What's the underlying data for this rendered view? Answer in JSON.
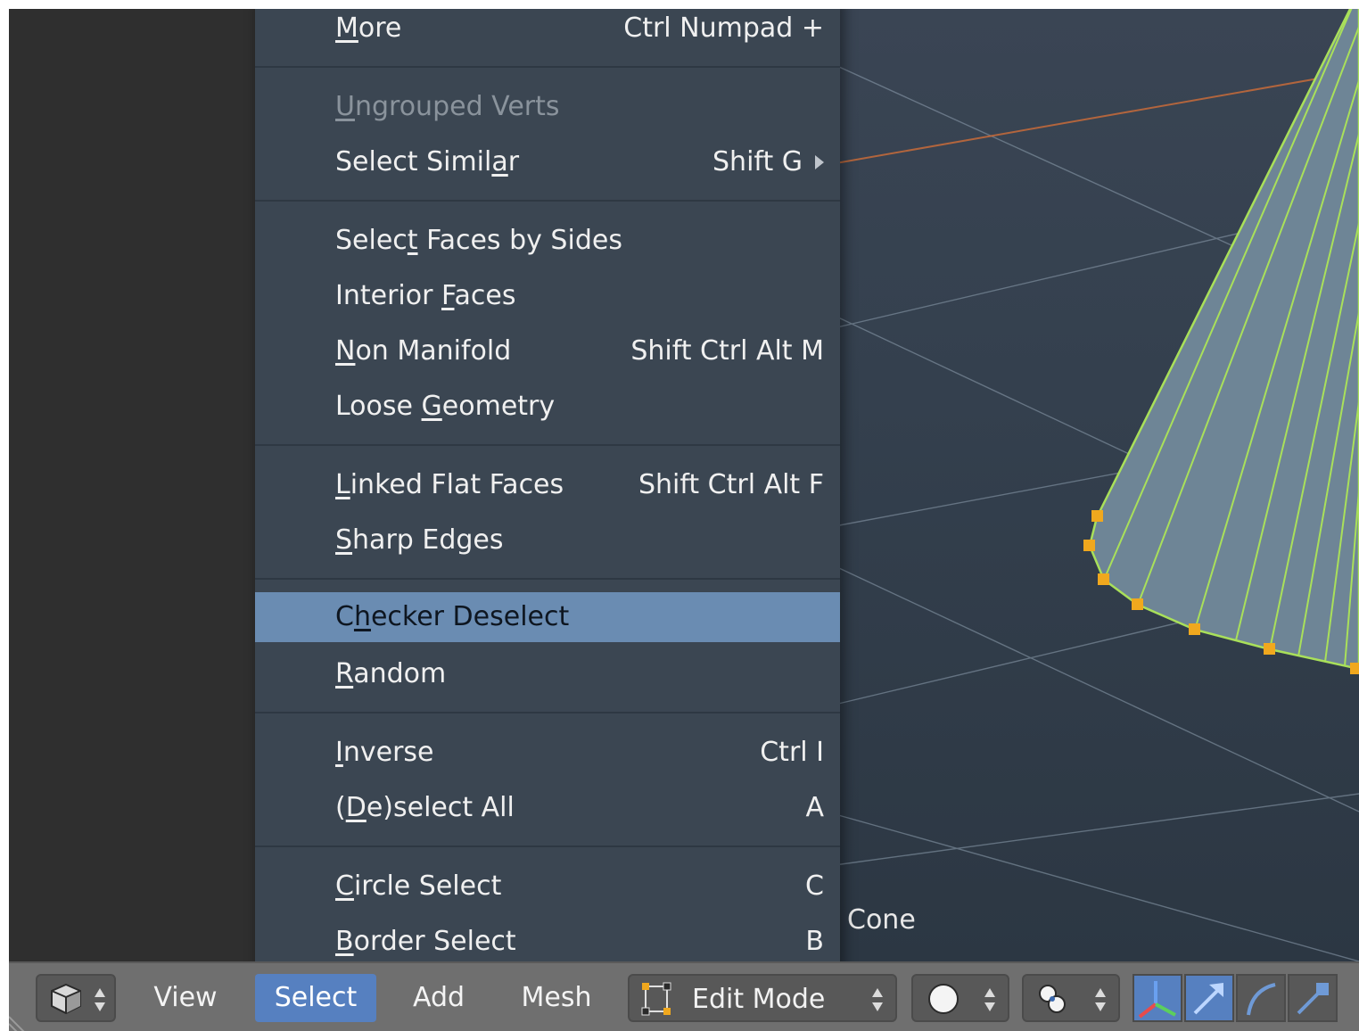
{
  "menu": {
    "items": [
      {
        "label": "More",
        "underline": "M",
        "shortcut": "Ctrl Numpad +",
        "state": "normal"
      },
      {
        "label": "Ungrouped Verts",
        "underline": "U",
        "shortcut": "",
        "state": "disabled"
      },
      {
        "label": "Select Similar",
        "underline": "a",
        "shortcut": "Shift G",
        "state": "normal",
        "submenu": true
      },
      {
        "label": "Select Faces by Sides",
        "underline": "t",
        "shortcut": "",
        "state": "normal"
      },
      {
        "label": "Interior Faces",
        "underline": "F",
        "shortcut": "",
        "state": "normal"
      },
      {
        "label": "Non Manifold",
        "underline": "N",
        "shortcut": "Shift Ctrl Alt M",
        "state": "normal"
      },
      {
        "label": "Loose Geometry",
        "underline": "G",
        "shortcut": "",
        "state": "normal"
      },
      {
        "label": "Linked Flat Faces",
        "underline": "L",
        "shortcut": "Shift Ctrl Alt F",
        "state": "normal"
      },
      {
        "label": "Sharp Edges",
        "underline": "S",
        "shortcut": "",
        "state": "normal"
      },
      {
        "label": "Checker Deselect",
        "underline": "h",
        "shortcut": "",
        "state": "highlighted"
      },
      {
        "label": "Random",
        "underline": "R",
        "shortcut": "",
        "state": "normal"
      },
      {
        "label": "Inverse",
        "underline": "I",
        "shortcut": "Ctrl I",
        "state": "normal"
      },
      {
        "label": "(De)select All",
        "underline": "D",
        "shortcut": "A",
        "state": "normal"
      },
      {
        "label": "Circle Select",
        "underline": "C",
        "shortcut": "C",
        "state": "normal"
      },
      {
        "label": "Border Select",
        "underline": "B",
        "shortcut": "B",
        "state": "normal"
      }
    ]
  },
  "viewport": {
    "object_name": "Cone"
  },
  "header": {
    "editor_type_icon": "cube-icon",
    "menus": [
      "View",
      "Select",
      "Add",
      "Mesh"
    ],
    "active_menu": "Select",
    "mode": "Edit Mode",
    "mode_icon": "edit-mesh-icon",
    "shading_icon": "sphere-shading-icon",
    "pivot_icon": "pivot-icon",
    "manipulator_icons": [
      "axis-gizmo-icon",
      "translate-arrow-icon",
      "rotate-arc-icon",
      "scale-icon"
    ]
  },
  "colors": {
    "menu_bg": "#3b4652",
    "highlight": "#6a8cb2",
    "header_bg": "#6f6f6f",
    "active_button": "#5680c0",
    "mesh_edge": "#a9e05a",
    "vertex": "#f0a81e"
  }
}
